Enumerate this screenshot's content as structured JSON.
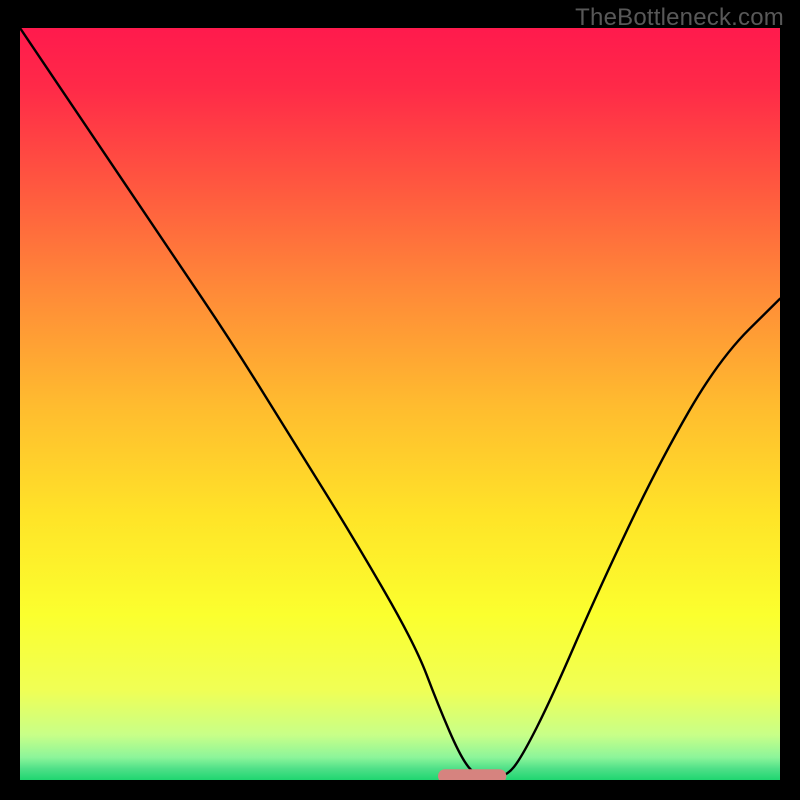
{
  "watermark": "TheBottleneck.com",
  "chart_data": {
    "type": "line",
    "title": "",
    "xlabel": "",
    "ylabel": "",
    "xlim": [
      0,
      100
    ],
    "ylim": [
      0,
      100
    ],
    "grid": false,
    "series": [
      {
        "name": "bottleneck-curve",
        "x": [
          0,
          10,
          20,
          28,
          36,
          44,
          52,
          55,
          58,
          60,
          62,
          64,
          66,
          70,
          76,
          84,
          92,
          100
        ],
        "values": [
          100,
          85,
          70,
          58,
          45,
          32,
          18,
          10,
          3,
          0.5,
          0.5,
          0.5,
          3,
          11,
          25,
          42,
          56,
          64
        ]
      }
    ],
    "annotations": [
      {
        "name": "valley-marker",
        "shape": "rounded-segment",
        "x_range": [
          55,
          64
        ],
        "y": 0.5,
        "color": "#d6837f"
      }
    ],
    "background_gradient": {
      "stops": [
        {
          "offset": 0.0,
          "color": "#ff1a4d"
        },
        {
          "offset": 0.08,
          "color": "#ff2a48"
        },
        {
          "offset": 0.2,
          "color": "#ff5440"
        },
        {
          "offset": 0.35,
          "color": "#ff8a38"
        },
        {
          "offset": 0.5,
          "color": "#ffbb2f"
        },
        {
          "offset": 0.65,
          "color": "#ffe428"
        },
        {
          "offset": 0.78,
          "color": "#fbff2e"
        },
        {
          "offset": 0.88,
          "color": "#f0ff55"
        },
        {
          "offset": 0.94,
          "color": "#c8ff88"
        },
        {
          "offset": 0.97,
          "color": "#8cf59a"
        },
        {
          "offset": 0.985,
          "color": "#4fe088"
        },
        {
          "offset": 1.0,
          "color": "#1fd670"
        }
      ]
    }
  }
}
